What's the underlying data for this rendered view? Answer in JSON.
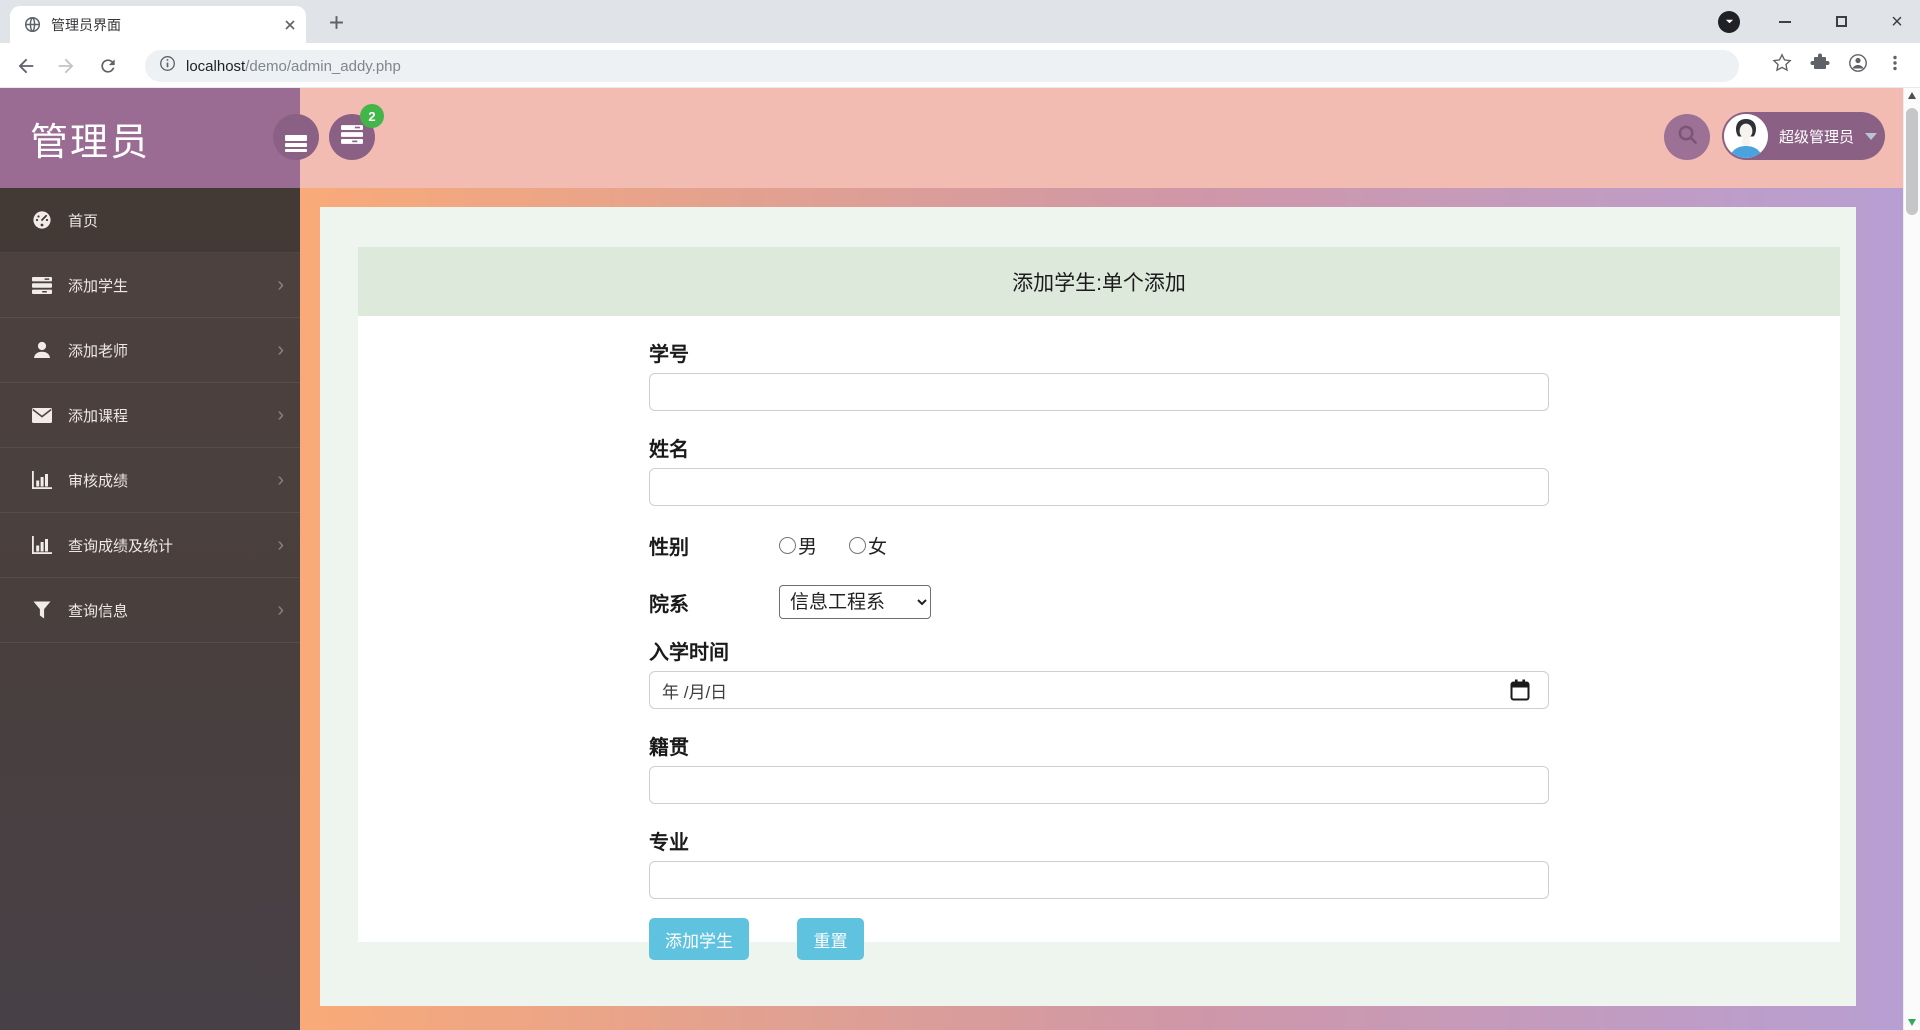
{
  "browser": {
    "tab_title": "管理员界面",
    "url_host": "localhost",
    "url_path": "/demo/admin_addy.php"
  },
  "sidebar": {
    "brand": "管理员",
    "chevron": "›",
    "items": [
      {
        "label": "首页",
        "icon": "dashboard-icon",
        "active": true
      },
      {
        "label": "添加学生",
        "icon": "tasks-icon"
      },
      {
        "label": "添加老师",
        "icon": "user-icon"
      },
      {
        "label": "添加课程",
        "icon": "envelope-icon"
      },
      {
        "label": "审核成绩",
        "icon": "bar-chart-icon"
      },
      {
        "label": "查询成绩及统计",
        "icon": "bar-chart-icon"
      },
      {
        "label": "查询信息",
        "icon": "filter-icon"
      }
    ]
  },
  "topbar": {
    "notification_count": "2",
    "admin_name": "超级管理员"
  },
  "form": {
    "title": "添加学生:单个添加",
    "student_id_label": "学号",
    "name_label": "姓名",
    "gender_label": "性别",
    "gender_male": "男",
    "gender_female": "女",
    "department_label": "院系",
    "department_selected": "信息工程系",
    "enroll_label": "入学时间",
    "enroll_placeholder": "年 /月/日",
    "hometown_label": "籍贯",
    "major_label": "专业",
    "submit_label": "添加学生",
    "reset_label": "重置"
  },
  "colors": {
    "sidebar_purple": "#9a6b93",
    "sidebar_dark": "#4a3e3b",
    "topbar_pink": "#f2bcb3",
    "badge_green": "#43b649",
    "button_blue": "#5fc2df",
    "card_mint": "#eef5ee",
    "band_green": "#dce9db",
    "main_gradient": [
      "#f9aa78",
      "#cf97a8",
      "#b79fd4"
    ]
  }
}
